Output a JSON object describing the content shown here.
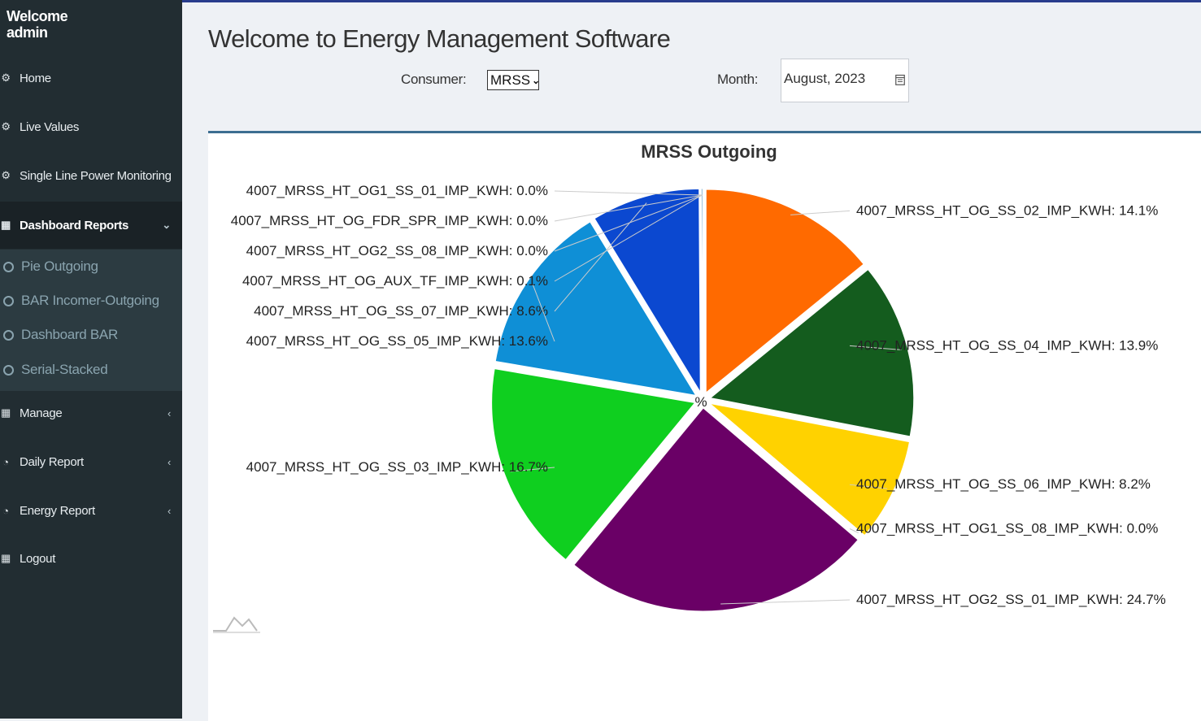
{
  "sidebar": {
    "welcome_line1": "Welcome",
    "welcome_line2": "admin",
    "items": [
      {
        "label": "Home",
        "icon": "dashboard-icon"
      },
      {
        "label": "Live Values",
        "icon": "dashboard-icon"
      },
      {
        "label": "Single Line Power Monitoring",
        "icon": "dashboard-icon"
      },
      {
        "label": "Dashboard Reports",
        "icon": "table-icon",
        "caret": "chevron-down-icon"
      },
      {
        "label": "Manage",
        "icon": "table-icon",
        "caret": "chevron-left-icon"
      },
      {
        "label": "Daily Report",
        "icon": "pie-chart-icon",
        "caret": "chevron-left-icon"
      },
      {
        "label": "Energy Report",
        "icon": "pie-chart-icon",
        "caret": "chevron-left-icon"
      },
      {
        "label": "Logout",
        "icon": "table-icon"
      }
    ],
    "submenu": [
      {
        "label": "Pie Outgoing"
      },
      {
        "label": "BAR Incomer-Outgoing"
      },
      {
        "label": "Dashboard BAR"
      },
      {
        "label": "Serial-Stacked"
      }
    ]
  },
  "header": {
    "title": "Welcome to Energy Management Software",
    "consumer_label": "Consumer:",
    "consumer_value": "MRSS",
    "month_label": "Month:",
    "month_value": "August, 2023"
  },
  "colors": {
    "sidebar_bg": "#222d32",
    "panel_border": "#3c6e91"
  },
  "chart_data": {
    "type": "pie",
    "title": "MRSS Outgoing",
    "center_label": "%",
    "slices": [
      {
        "label": "4007_MRSS_HT_OG_SS_02_IMP_KWH",
        "value": 14.1,
        "color": "#ff6a00"
      },
      {
        "label": "4007_MRSS_HT_OG_SS_04_IMP_KWH",
        "value": 13.9,
        "color": "#145c1e"
      },
      {
        "label": "4007_MRSS_HT_OG_SS_06_IMP_KWH",
        "value": 8.2,
        "color": "#ffd200"
      },
      {
        "label": "4007_MRSS_HT_OG1_SS_08_IMP_KWH",
        "value": 0.0,
        "color": "#dc3912"
      },
      {
        "label": "4007_MRSS_HT_OG2_SS_01_IMP_KWH",
        "value": 24.7,
        "color": "#6a0066"
      },
      {
        "label": "4007_MRSS_HT_OG_SS_03_IMP_KWH",
        "value": 16.7,
        "color": "#0fcf1f"
      },
      {
        "label": "4007_MRSS_HT_OG_SS_05_IMP_KWH",
        "value": 13.6,
        "color": "#0f8fd6"
      },
      {
        "label": "4007_MRSS_HT_OG_SS_07_IMP_KWH",
        "value": 8.6,
        "color": "#0b48d0"
      },
      {
        "label": "4007_MRSS_HT_OG_AUX_TF_IMP_KWH",
        "value": 0.1,
        "color": "#2c7fb8"
      },
      {
        "label": "4007_MRSS_HT_OG1_SS_01_IMP_KWH",
        "value": 0.0,
        "color": "#888888"
      },
      {
        "label": "4007_MRSS_HT_OG_FDR_SPR_IMP_KWH",
        "value": 0.0,
        "color": "#888888"
      },
      {
        "label": "4007_MRSS_HT_OG2_SS_08_IMP_KWH",
        "value": 0.0,
        "color": "#888888"
      }
    ]
  }
}
